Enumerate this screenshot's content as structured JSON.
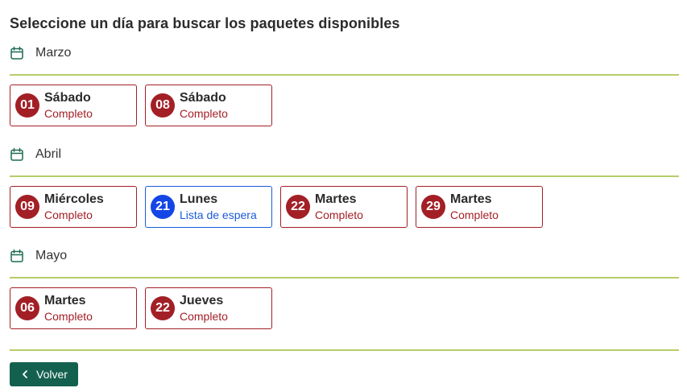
{
  "page": {
    "title": "Seleccione un día para buscar los paquetes disponibles"
  },
  "months": [
    {
      "name": "Marzo",
      "days": [
        {
          "num": "01",
          "name": "Sábado",
          "status": "Completo"
        },
        {
          "num": "08",
          "name": "Sábado",
          "status": "Completo"
        }
      ]
    },
    {
      "name": "Abril",
      "days": [
        {
          "num": "09",
          "name": "Miércoles",
          "status": "Completo"
        },
        {
          "num": "21",
          "name": "Lunes",
          "status": "Lista de espera"
        },
        {
          "num": "22",
          "name": "Martes",
          "status": "Completo"
        },
        {
          "num": "29",
          "name": "Martes",
          "status": "Completo"
        }
      ]
    },
    {
      "name": "Mayo",
      "days": [
        {
          "num": "06",
          "name": "Martes",
          "status": "Completo"
        },
        {
          "num": "22",
          "name": "Jueves",
          "status": "Completo"
        }
      ]
    }
  ],
  "actions": {
    "back_label": "Volver",
    "back_icon": "chevron-left-icon"
  },
  "colors": {
    "complete": "#a31f26",
    "waitlist": "#1a5bd8",
    "rule": "#b5cd6a",
    "button": "#14604f",
    "calendar_icon": "#1c6a55"
  }
}
